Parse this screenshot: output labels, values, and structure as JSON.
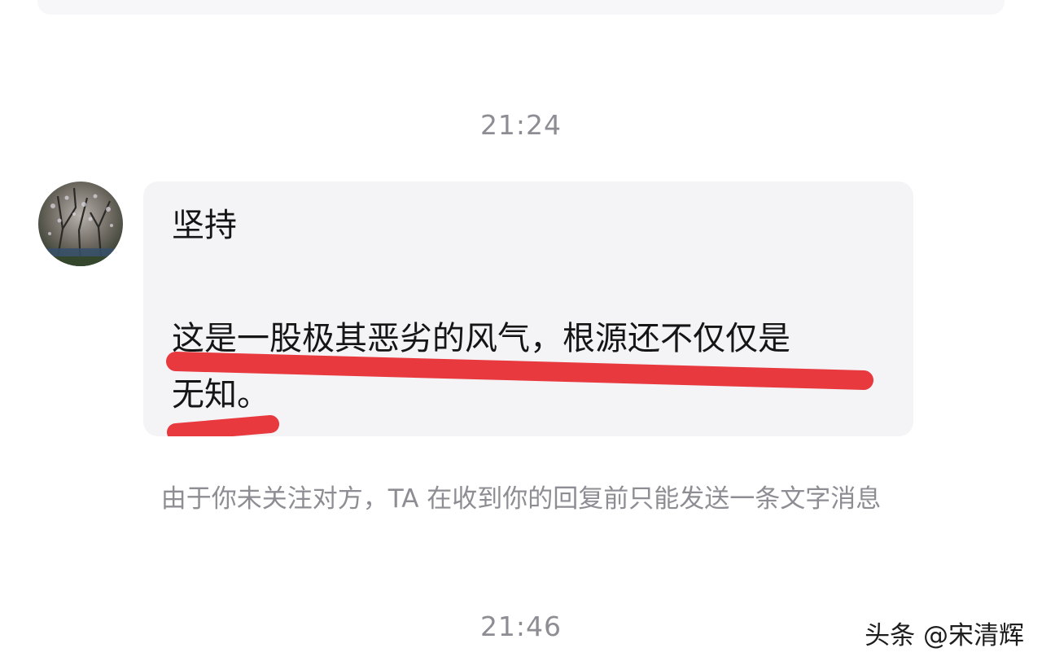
{
  "conversation": {
    "timestamps": [
      "21:24",
      "21:46"
    ],
    "message": {
      "lines": [
        "坚持",
        "这是一股极其恶劣的风气，根源还不仅仅是",
        "无知。"
      ],
      "highlight_color": "#e8393f"
    },
    "notice": "由于你未关注对方，TA 在收到你的回复前只能发送一条文字消息"
  },
  "watermark": "头条 @宋清辉",
  "colors": {
    "bubble_bg": "#f4f4f6",
    "timestamp": "#8d8d93",
    "message_text": "#151515"
  }
}
